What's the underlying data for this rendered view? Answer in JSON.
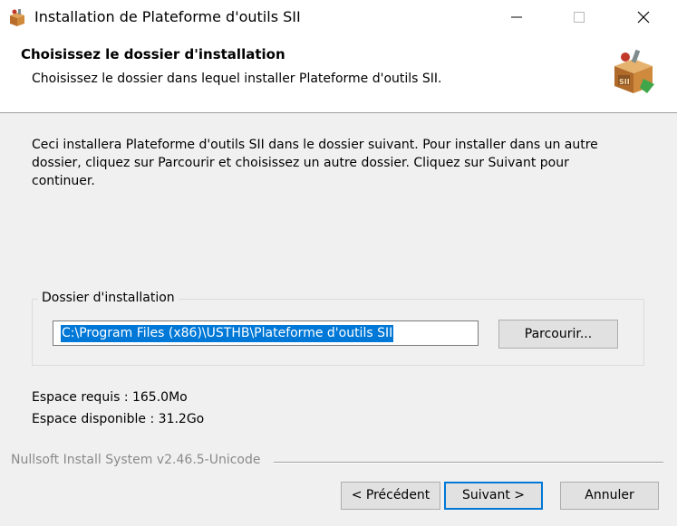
{
  "window": {
    "title": "Installation de Plateforme d'outils SII",
    "icon": "installer-box-icon",
    "controls": [
      "minimize-icon",
      "maximize-icon",
      "close-icon"
    ]
  },
  "header": {
    "title": "Choisissez le dossier d'installation",
    "subtitle": "Choisissez le dossier dans lequel installer Plateforme d'outils SII.",
    "icon": "installer-box-icon"
  },
  "body": {
    "intro": "Ceci installera Plateforme d'outils SII dans le dossier suivant. Pour installer dans un autre dossier, cliquez sur Parcourir et choisissez un autre dossier. Cliquez sur Suivant pour continuer."
  },
  "install_folder": {
    "legend": "Dossier d'installation",
    "path": "C:\\Program Files (x86)\\USTHB\\Plateforme d'outils SII",
    "browse_label": "Parcourir..."
  },
  "space": {
    "required": "Espace requis : 165.0Mo",
    "available": "Espace disponible : 31.2Go"
  },
  "branding": "Nullsoft Install System v2.46.5-Unicode",
  "buttons": {
    "back": "< Précédent",
    "next": "Suivant >",
    "cancel": "Annuler"
  },
  "colors": {
    "selection": "#0078d7",
    "default_button_border": "#0078d7"
  }
}
